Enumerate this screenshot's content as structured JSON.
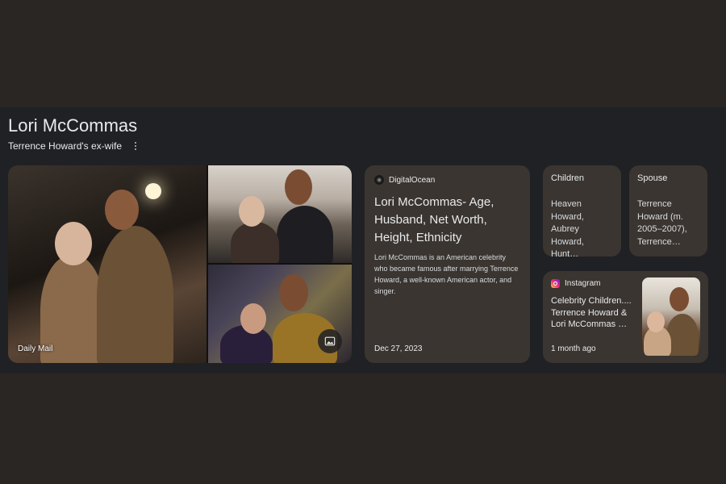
{
  "entity": {
    "name": "Lori McCommas",
    "subtitle": "Terrence Howard's ex-wife"
  },
  "images": {
    "source_label": "Daily Mail"
  },
  "article": {
    "source": "DigitalOcean",
    "title": "Lori McCommas- Age, Husband, Net Worth, Height, Ethnicity",
    "description": "Lori McCommas is an American celebrity who became famous after marrying Terrence Howard, a well-known American actor, and singer.",
    "date": "Dec 27, 2023"
  },
  "facts": {
    "children": {
      "label": "Children",
      "value": "Heaven Howard, Aubrey Howard, Hunt…"
    },
    "spouse": {
      "label": "Spouse",
      "value": "Terrence Howard (m. 2005–2007), Terrence…"
    }
  },
  "instagram": {
    "source": "Instagram",
    "title": "Celebrity Children.... Terrence Howard & Lori McCommas …",
    "time": "1 month ago"
  },
  "icons": {
    "more": "more-vert-icon",
    "expand": "image-icon",
    "instagram": "instagram-icon",
    "digitalocean": "digitalocean-favicon-icon"
  },
  "colors": {
    "page_bg": "#2a2623",
    "panel_bg": "#202124",
    "card_bg": "#3a3530",
    "text": "#e8eaed"
  }
}
